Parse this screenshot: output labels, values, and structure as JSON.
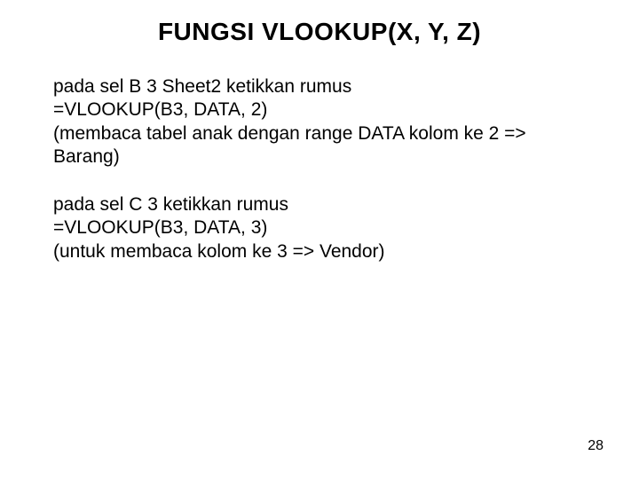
{
  "title": "FUNGSI VLOOKUP(X, Y, Z)",
  "para1_line1": "pada sel B 3 Sheet2 ketikkan rumus",
  "para1_line2": "=VLOOKUP(B3, DATA, 2)",
  "para1_line3": "(membaca tabel anak dengan range DATA kolom ke 2 => Barang)",
  "para2_line1": "pada sel C 3 ketikkan rumus",
  "para2_line2": "=VLOOKUP(B3, DATA, 3)",
  "para2_line3": "(untuk membaca kolom ke 3 => Vendor)",
  "page_number": "28"
}
